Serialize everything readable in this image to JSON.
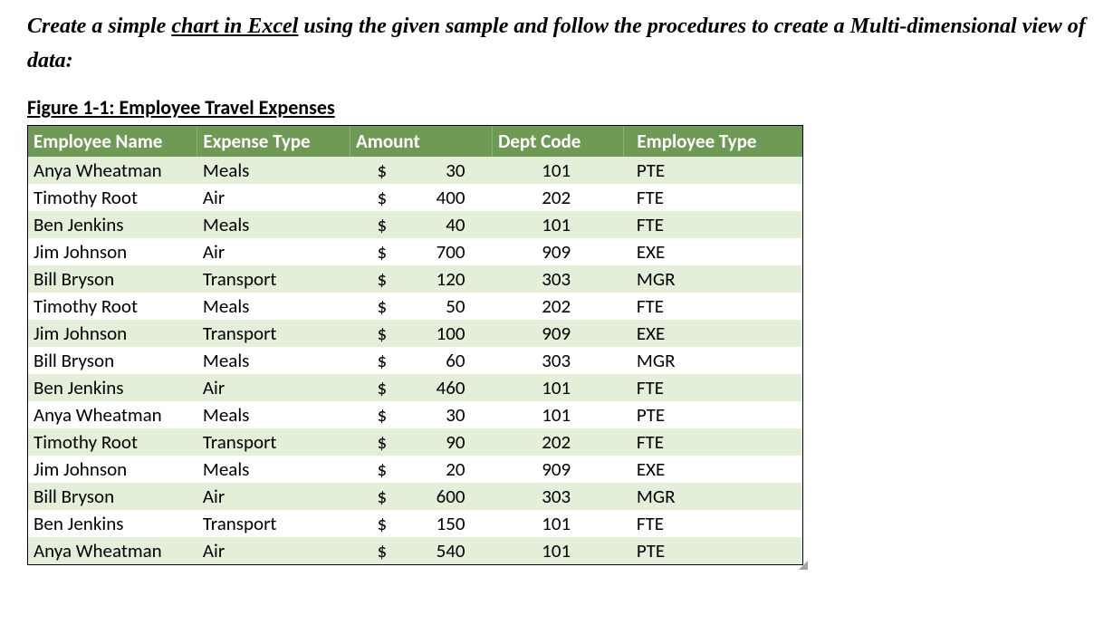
{
  "instruction": {
    "pre": "Create a simple ",
    "underlined": "chart in Excel",
    "post": " using the given sample and follow the procedures to create a Multi-dimensional view of data:"
  },
  "figure_title": "Figure 1-1: Employee Travel Expenses",
  "columns": {
    "name": "Employee Name",
    "expense_type": "Expense Type",
    "amount": "Amount",
    "dept_code": "Dept Code",
    "employee_type": "Employee Type"
  },
  "currency_symbol": "$",
  "rows": [
    {
      "name": "Anya Wheatman",
      "expense_type": "Meals",
      "amount": 30,
      "dept_code": 101,
      "employee_type": "PTE"
    },
    {
      "name": "Timothy Root",
      "expense_type": "Air",
      "amount": 400,
      "dept_code": 202,
      "employee_type": "FTE"
    },
    {
      "name": "Ben Jenkins",
      "expense_type": "Meals",
      "amount": 40,
      "dept_code": 101,
      "employee_type": "FTE"
    },
    {
      "name": "Jim Johnson",
      "expense_type": "Air",
      "amount": 700,
      "dept_code": 909,
      "employee_type": "EXE"
    },
    {
      "name": "Bill Bryson",
      "expense_type": "Transport",
      "amount": 120,
      "dept_code": 303,
      "employee_type": "MGR"
    },
    {
      "name": "Timothy Root",
      "expense_type": "Meals",
      "amount": 50,
      "dept_code": 202,
      "employee_type": "FTE"
    },
    {
      "name": "Jim Johnson",
      "expense_type": "Transport",
      "amount": 100,
      "dept_code": 909,
      "employee_type": "EXE"
    },
    {
      "name": "Bill Bryson",
      "expense_type": "Meals",
      "amount": 60,
      "dept_code": 303,
      "employee_type": "MGR"
    },
    {
      "name": "Ben Jenkins",
      "expense_type": "Air",
      "amount": 460,
      "dept_code": 101,
      "employee_type": "FTE"
    },
    {
      "name": "Anya Wheatman",
      "expense_type": "Meals",
      "amount": 30,
      "dept_code": 101,
      "employee_type": "PTE"
    },
    {
      "name": "Timothy Root",
      "expense_type": "Transport",
      "amount": 90,
      "dept_code": 202,
      "employee_type": "FTE"
    },
    {
      "name": "Jim Johnson",
      "expense_type": "Meals",
      "amount": 20,
      "dept_code": 909,
      "employee_type": "EXE"
    },
    {
      "name": "Bill Bryson",
      "expense_type": "Air",
      "amount": 600,
      "dept_code": 303,
      "employee_type": "MGR"
    },
    {
      "name": "Ben Jenkins",
      "expense_type": "Transport",
      "amount": 150,
      "dept_code": 101,
      "employee_type": "FTE"
    },
    {
      "name": "Anya Wheatman",
      "expense_type": "Air",
      "amount": 540,
      "dept_code": 101,
      "employee_type": "PTE"
    }
  ],
  "chart_data": {
    "type": "table",
    "title": "Figure 1-1: Employee Travel Expenses",
    "columns": [
      "Employee Name",
      "Expense Type",
      "Amount",
      "Dept Code",
      "Employee Type"
    ],
    "rows": [
      [
        "Anya Wheatman",
        "Meals",
        30,
        101,
        "PTE"
      ],
      [
        "Timothy Root",
        "Air",
        400,
        202,
        "FTE"
      ],
      [
        "Ben Jenkins",
        "Meals",
        40,
        101,
        "FTE"
      ],
      [
        "Jim Johnson",
        "Air",
        700,
        909,
        "EXE"
      ],
      [
        "Bill Bryson",
        "Transport",
        120,
        303,
        "MGR"
      ],
      [
        "Timothy Root",
        "Meals",
        50,
        202,
        "FTE"
      ],
      [
        "Jim Johnson",
        "Transport",
        100,
        909,
        "EXE"
      ],
      [
        "Bill Bryson",
        "Meals",
        60,
        303,
        "MGR"
      ],
      [
        "Ben Jenkins",
        "Air",
        460,
        101,
        "FTE"
      ],
      [
        "Anya Wheatman",
        "Meals",
        30,
        101,
        "PTE"
      ],
      [
        "Timothy Root",
        "Transport",
        90,
        202,
        "FTE"
      ],
      [
        "Jim Johnson",
        "Meals",
        20,
        909,
        "EXE"
      ],
      [
        "Bill Bryson",
        "Air",
        600,
        303,
        "MGR"
      ],
      [
        "Ben Jenkins",
        "Transport",
        150,
        101,
        "FTE"
      ],
      [
        "Anya Wheatman",
        "Air",
        540,
        101,
        "PTE"
      ]
    ]
  }
}
